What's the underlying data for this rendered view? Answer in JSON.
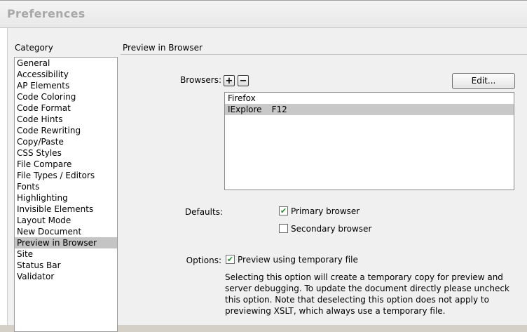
{
  "window": {
    "title": "Preferences"
  },
  "category": {
    "label": "Category",
    "items": [
      "General",
      "Accessibility",
      "AP Elements",
      "Code Coloring",
      "Code Format",
      "Code Hints",
      "Code Rewriting",
      "Copy/Paste",
      "CSS Styles",
      "File Compare",
      "File Types / Editors",
      "Fonts",
      "Highlighting",
      "Invisible Elements",
      "Layout Mode",
      "New Document",
      "Preview in Browser",
      "Site",
      "Status Bar",
      "Validator"
    ],
    "selected": "Preview in Browser"
  },
  "section": {
    "title": "Preview in Browser"
  },
  "browsers": {
    "label": "Browsers:",
    "add_icon": "plus-icon",
    "remove_icon": "minus-icon",
    "add_symbol": "+",
    "remove_symbol": "−",
    "edit_label": "Edit...",
    "list": [
      {
        "name": "Firefox",
        "shortcut": ""
      },
      {
        "name": "IExplore",
        "shortcut": "F12"
      }
    ],
    "selected_index": 1
  },
  "defaults": {
    "label": "Defaults:",
    "primary": {
      "label": "Primary browser",
      "checked": true
    },
    "secondary": {
      "label": "Secondary browser",
      "checked": false
    }
  },
  "options": {
    "label": "Options:",
    "temp_file": {
      "label": "Preview using temporary file",
      "checked": true
    },
    "description": "Selecting this option will create a temporary copy for preview and server debugging. To update the document directly please uncheck this option. Note that deselecting this option does not apply to previewing XSLT, which always use a temporary file."
  },
  "colors": {
    "check": "#2a8a2a",
    "selection": "#c4c4c4"
  }
}
